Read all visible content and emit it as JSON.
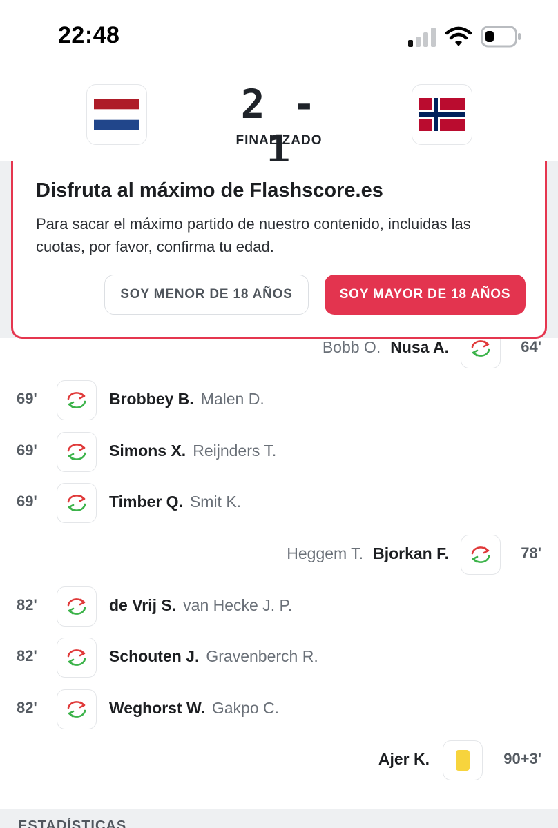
{
  "status_bar": {
    "time": "22:48",
    "signal_icon": "cellular-signal-icon",
    "wifi_icon": "wifi-icon",
    "battery_icon": "battery-low-icon"
  },
  "match": {
    "home_flag": "netherlands-flag",
    "away_flag": "norway-flag",
    "score": "2 - 1",
    "status": "FINALIZADO"
  },
  "consent_banner": {
    "title": "Disfruta al máximo de Flashscore.es",
    "text": "Para sacar el máximo partido de nuestro contenido, incluidas las cuotas, por favor, confirma tu edad.",
    "minor_button": "SOY MENOR DE 18 AÑOS",
    "major_button": "SOY MAYOR DE 18 AÑOS",
    "accent_color": "#e3344f"
  },
  "events": [
    {
      "side": "away",
      "type": "substitution",
      "minute": "64'",
      "player_in": "Nusa A.",
      "player_out": "Bobb O."
    },
    {
      "side": "home",
      "type": "substitution",
      "minute": "69'",
      "player_in": "Brobbey B.",
      "player_out": "Malen D."
    },
    {
      "side": "home",
      "type": "substitution",
      "minute": "69'",
      "player_in": "Simons X.",
      "player_out": "Reijnders T."
    },
    {
      "side": "home",
      "type": "substitution",
      "minute": "69'",
      "player_in": "Timber Q.",
      "player_out": "Smit K."
    },
    {
      "side": "away",
      "type": "substitution",
      "minute": "78'",
      "player_in": "Bjorkan F.",
      "player_out": "Heggem T."
    },
    {
      "side": "home",
      "type": "substitution",
      "minute": "82'",
      "player_in": "de Vrij S.",
      "player_out": "van Hecke J. P."
    },
    {
      "side": "home",
      "type": "substitution",
      "minute": "82'",
      "player_in": "Schouten J.",
      "player_out": "Gravenberch R."
    },
    {
      "side": "home",
      "type": "substitution",
      "minute": "82'",
      "player_in": "Weghorst W.",
      "player_out": "Gakpo C."
    },
    {
      "side": "away",
      "type": "yellow-card",
      "minute": "90+3'",
      "player": "Ajer K."
    }
  ],
  "section": {
    "stats_label": "ESTADÍSTICAS"
  }
}
